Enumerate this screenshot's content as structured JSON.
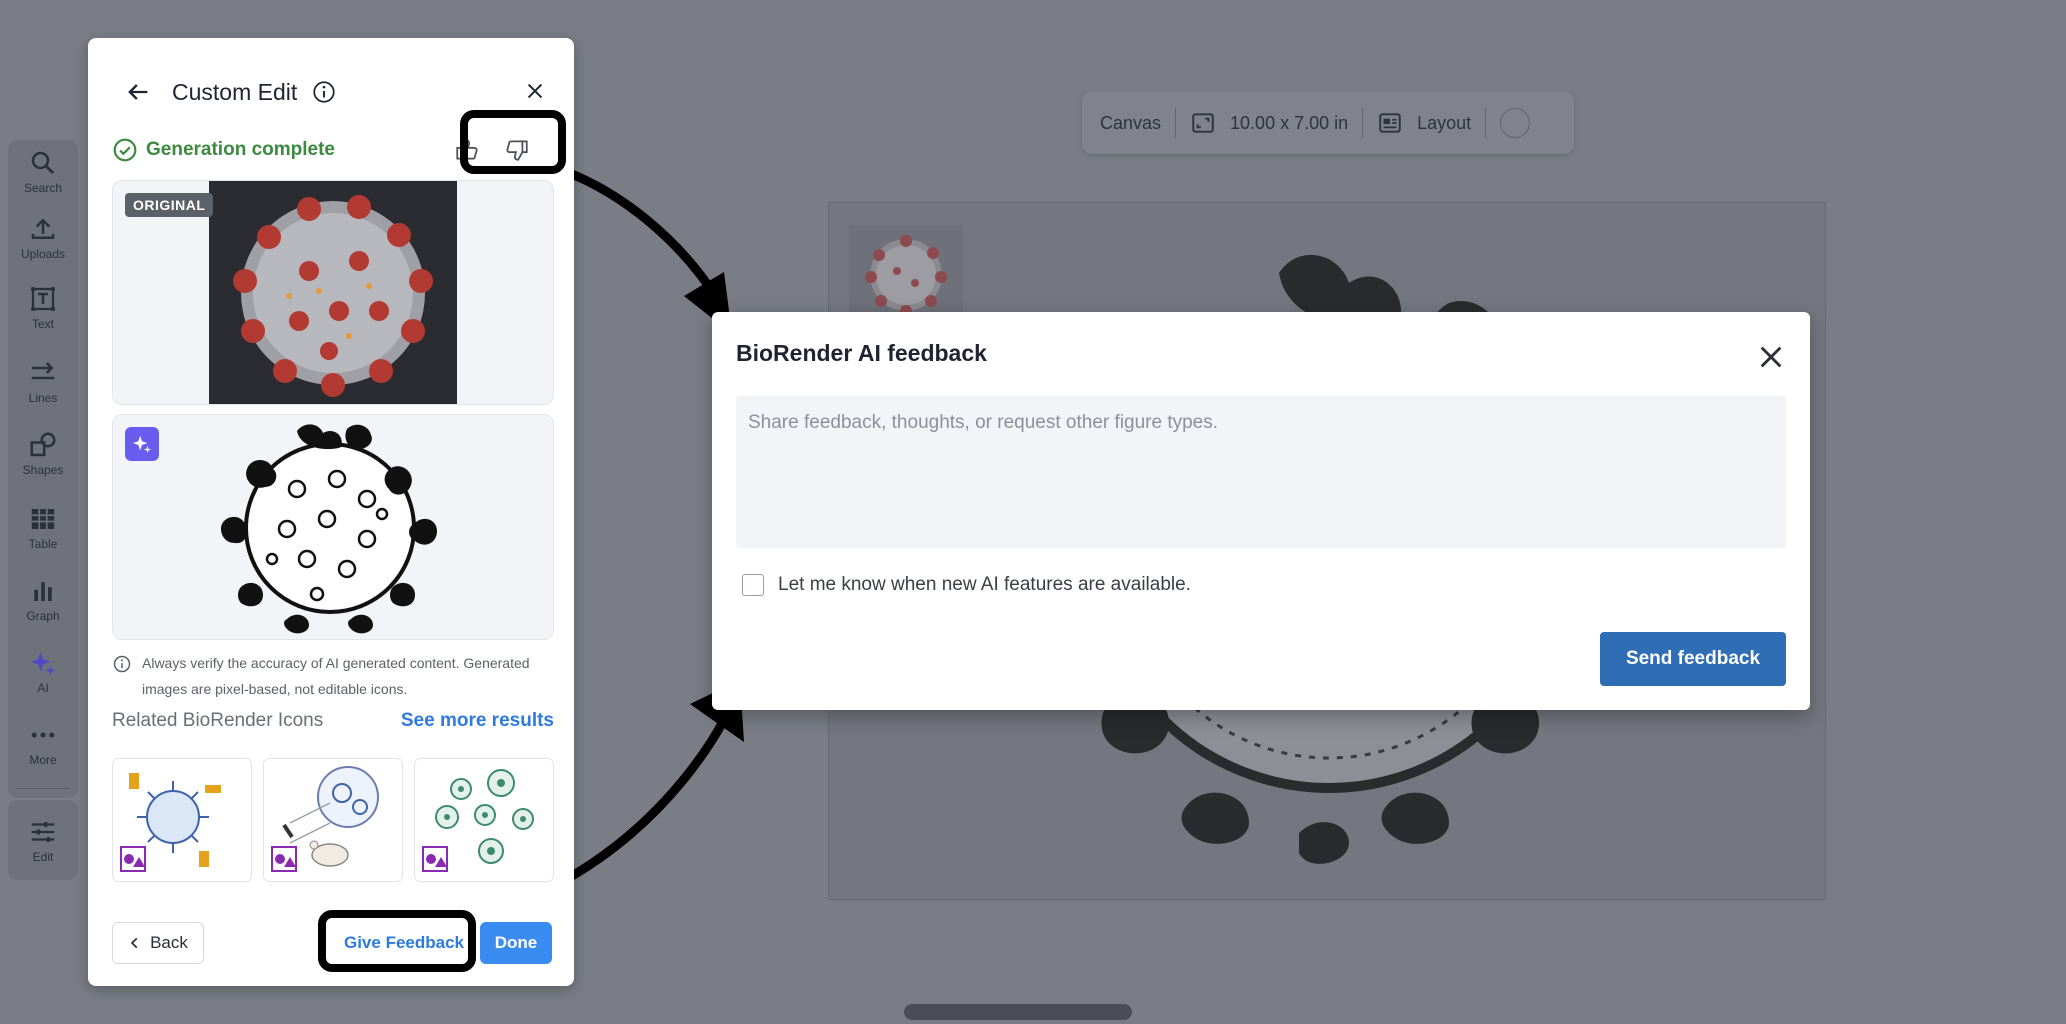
{
  "toolbar": {
    "items": [
      {
        "label": "Search",
        "icon": "search-icon"
      },
      {
        "label": "Uploads",
        "icon": "upload-icon"
      },
      {
        "label": "Text",
        "icon": "text-icon"
      },
      {
        "label": "Lines",
        "icon": "lines-icon"
      },
      {
        "label": "Shapes",
        "icon": "shapes-icon"
      },
      {
        "label": "Table",
        "icon": "table-icon"
      },
      {
        "label": "Graph",
        "icon": "graph-icon"
      },
      {
        "label": "AI",
        "icon": "sparkle-icon"
      },
      {
        "label": "More",
        "icon": "more-icon"
      },
      {
        "label": "Edit",
        "icon": "sliders-icon"
      }
    ]
  },
  "canvas_bar": {
    "canvas_label": "Canvas",
    "size_label": "10.00 x 7.00 in",
    "layout_label": "Layout"
  },
  "panel": {
    "title": "Custom Edit",
    "status": "Generation complete",
    "original_badge": "ORIGINAL",
    "disclaimer": "Always verify the accuracy of AI generated content. Generated images are pixel-based, not editable icons.",
    "related_title": "Related BioRender Icons",
    "see_more": "See more results",
    "back_label": "Back",
    "give_feedback_label": "Give Feedback",
    "done_label": "Done"
  },
  "modal": {
    "title": "BioRender AI feedback",
    "placeholder": "Share feedback, thoughts, or request other figure types.",
    "checkbox_label": "Let me know when new AI features are available.",
    "send_label": "Send feedback"
  },
  "colors": {
    "success": "#3b8a3f",
    "link": "#2f7ae0",
    "primary_button": "#3a8cf0",
    "send_button": "#2f6db5",
    "ai_badge": "#6b5cf0"
  }
}
